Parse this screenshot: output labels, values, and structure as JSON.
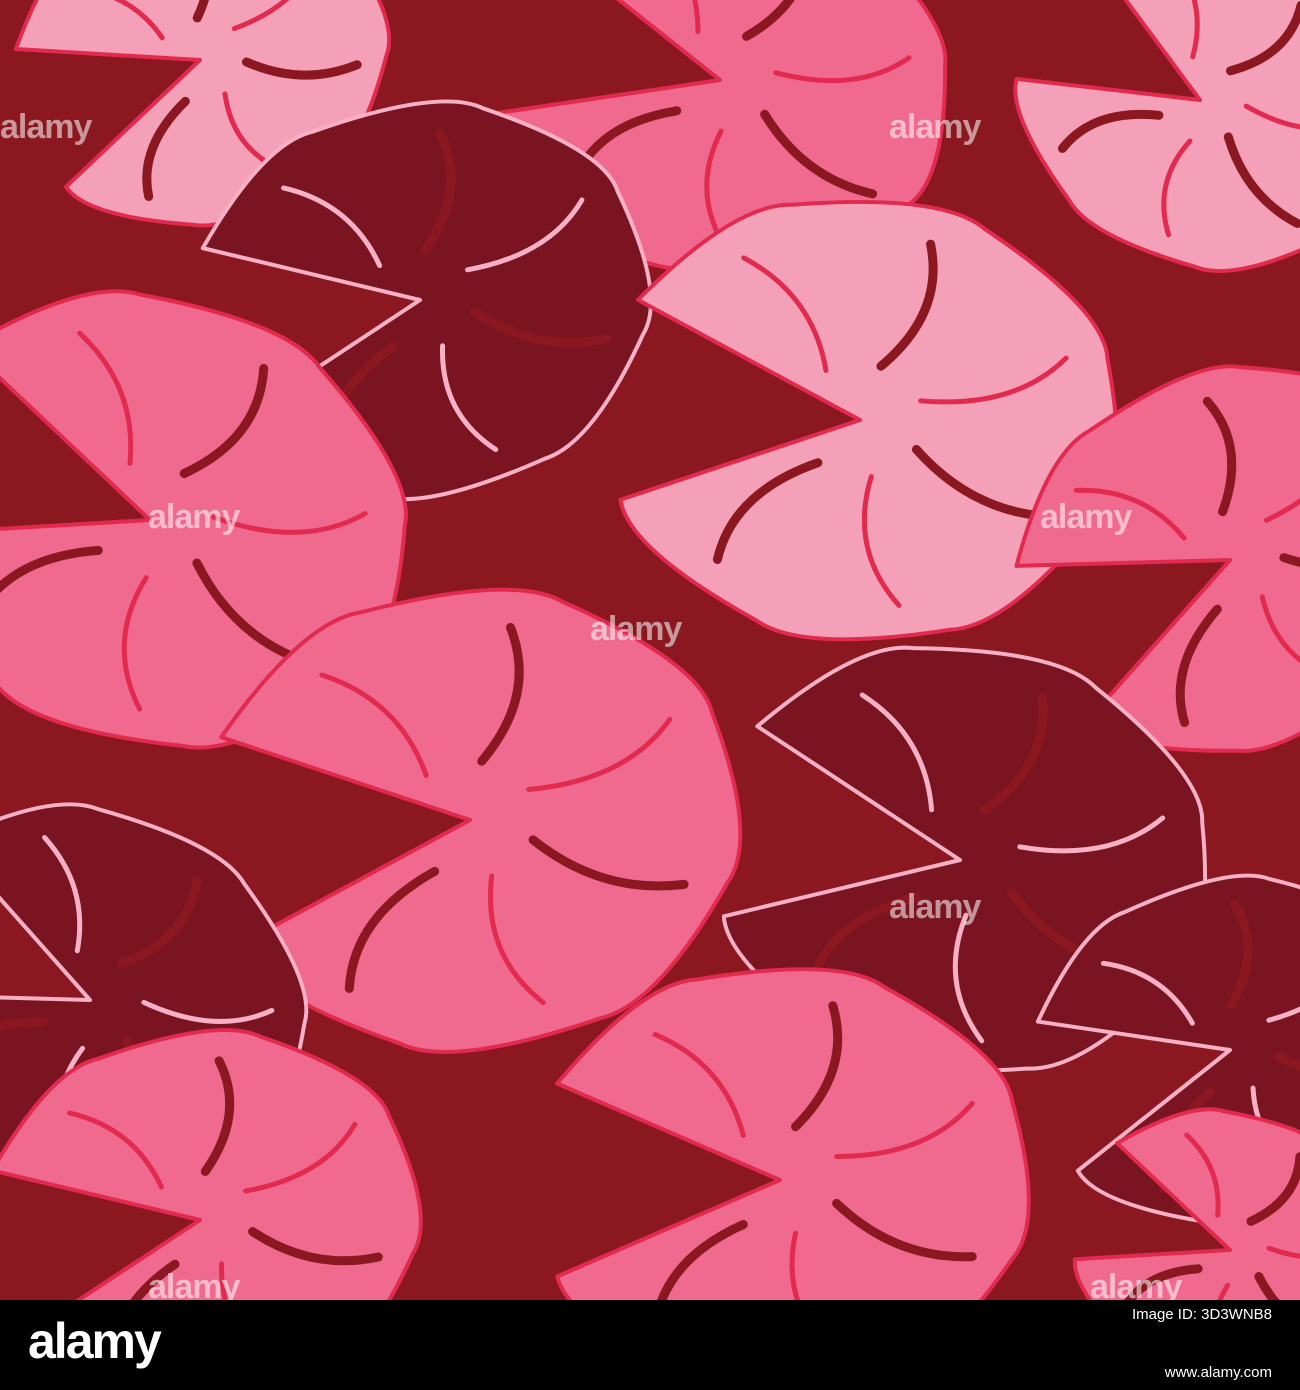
{
  "image": {
    "subject": "",
    "colors": {
      "background": "#8b1820",
      "leaf_light": "#f4a0b9",
      "leaf_mid": "#f06a90",
      "leaf_dark": "#7a1420",
      "stroke_red": "#e22a4e",
      "stroke_pink": "#f7b0c6"
    }
  },
  "watermark": {
    "text": "alamy",
    "count": 8
  },
  "footer": {
    "logo": "alamy",
    "image_id": "Image ID: 3D3WNB8",
    "url": "www.alamy.com"
  }
}
